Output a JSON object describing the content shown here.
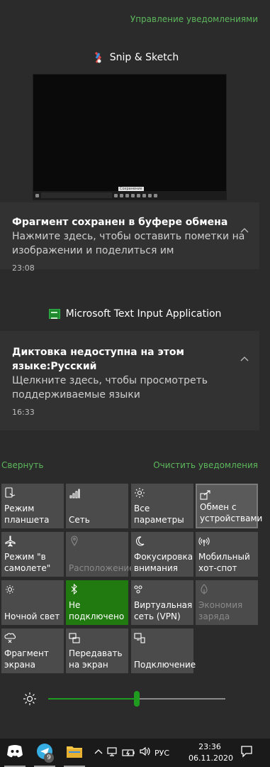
{
  "header": {
    "manage_label": "Управление уведомлениями"
  },
  "snip": {
    "app_name": "Snip & Sketch",
    "preview_tooltip": "Сохранение",
    "title": "Фрагмент сохранен в буфере обмена",
    "body": "Нажмите здесь, чтобы оставить пометки на изображении и поделиться им",
    "time": "23:08"
  },
  "mti": {
    "app_name": "Microsoft Text Input Application",
    "title": "Диктовка недоступна на этом языке:Русский",
    "body": "Щелкните здесь, чтобы просмотреть поддерживаемые языки",
    "time": "16:33"
  },
  "actions": {
    "collapse_label": "Свернуть",
    "clear_label": "Очистить уведомления"
  },
  "tiles": [
    {
      "label": "Режим планшета",
      "icon": "tablet-mode-icon",
      "state": "normal"
    },
    {
      "label": "Сеть",
      "icon": "network-icon",
      "state": "normal"
    },
    {
      "label": "Все параметры",
      "icon": "settings-gear-icon",
      "state": "normal"
    },
    {
      "label": "Обмен с устройствами",
      "icon": "share-icon",
      "state": "highlight"
    },
    {
      "label": "Режим \"в самолете\"",
      "icon": "airplane-icon",
      "state": "normal"
    },
    {
      "label": "Расположение",
      "icon": "location-icon",
      "state": "disabled"
    },
    {
      "label": "Фокусировка внимания",
      "icon": "moon-icon",
      "state": "normal"
    },
    {
      "label": "Мобильный хот-спот",
      "icon": "hotspot-icon",
      "state": "normal"
    },
    {
      "label": "Ночной свет",
      "icon": "night-light-icon",
      "state": "normal"
    },
    {
      "label": "Не подключено",
      "icon": "bluetooth-icon",
      "state": "active"
    },
    {
      "label": "Виртуальная сеть (VPN)",
      "icon": "vpn-icon",
      "state": "normal"
    },
    {
      "label": "Экономия заряда",
      "icon": "battery-saver-icon",
      "state": "disabled"
    },
    {
      "label": "Фрагмент экрана",
      "icon": "snip-icon",
      "state": "normal"
    },
    {
      "label": "Передавать на экран",
      "icon": "project-icon",
      "state": "normal"
    },
    {
      "label": "Подключение",
      "icon": "connect-icon",
      "state": "normal"
    }
  ],
  "brightness": {
    "value_percent": 50
  },
  "taskbar": {
    "telegram_badge": "9",
    "language": "РУС",
    "time": "23:36",
    "date": "06.11.2020"
  },
  "colors": {
    "accent": "#217a0f",
    "link": "#5cb85c",
    "background": "#2b2b2b"
  }
}
